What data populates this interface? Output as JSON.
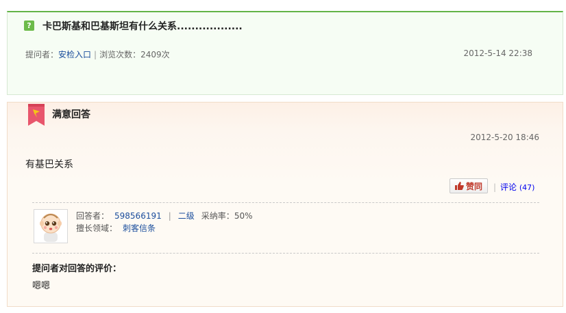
{
  "question": {
    "icon": "question-icon",
    "title": "卡巴斯基和巴基斯坦有什么关系..................",
    "asker_label": "提问者：",
    "asker_name": "安检入口",
    "separator": "|",
    "views_label": "浏览次数：",
    "views_value": "2409次",
    "date": "2012-5-14 22:38"
  },
  "answer": {
    "ribbon_icon": "best-answer-ribbon-icon",
    "title": "满意回答",
    "date": "2012-5-20 18:46",
    "content": "有基巴关系",
    "like_label": "赞同",
    "comment_label": "评论",
    "comment_count": "(47)",
    "answerer_label": "回答者：",
    "answerer_name": "598566191",
    "answerer_level": "二级",
    "adoption_label": "采纳率：",
    "adoption_value": "50%",
    "expertise_label": "擅长领域：",
    "expertise_value": "刺客信条",
    "evaluation_title": "提问者对回答的评价：",
    "evaluation_text": "嗯嗯"
  },
  "colors": {
    "accent_green": "#62b446",
    "link_blue": "#1a4d9c",
    "like_red": "#c0392b",
    "ribbon_red": "#e8566c",
    "ribbon_star": "#f5c518"
  }
}
